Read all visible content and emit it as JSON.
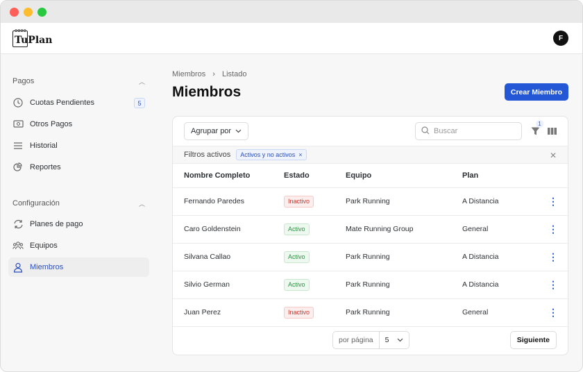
{
  "app": {
    "name": "TuPlan",
    "user_initial": "F"
  },
  "colors": {
    "primary": "#2457d6",
    "active": "#2f8f46",
    "inactive": "#c7362f"
  },
  "sidebar": {
    "pagos": {
      "title": "Pagos",
      "items": [
        {
          "label": "Cuotas Pendientes",
          "icon": "clock-icon",
          "count": "5"
        },
        {
          "label": "Otros Pagos",
          "icon": "cash-icon"
        },
        {
          "label": "Historial",
          "icon": "list-icon"
        },
        {
          "label": "Reportes",
          "icon": "pie-chart-icon"
        }
      ]
    },
    "config": {
      "title": "Configuración",
      "items": [
        {
          "label": "Planes de pago",
          "icon": "refresh-icon"
        },
        {
          "label": "Equipos",
          "icon": "group-icon"
        },
        {
          "label": "Miembros",
          "icon": "user-icon",
          "active": true
        }
      ]
    }
  },
  "main": {
    "breadcrumb": [
      "Miembros",
      "Listado"
    ],
    "title": "Miembros",
    "create_label": "Crear Miembro",
    "group_label": "Agrupar por",
    "search_placeholder": "Buscar",
    "filter_count": "1",
    "filters_label": "Filtros activos",
    "filter_chip": "Activos y no activos",
    "columns": [
      "Nombre Completo",
      "Estado",
      "Equipo",
      "Plan"
    ],
    "rows": [
      {
        "name": "Fernando Paredes",
        "status": "Inactivo",
        "team": "Park Running",
        "plan": "A Distancia"
      },
      {
        "name": "Caro Goldenstein",
        "status": "Activo",
        "team": "Mate Running Group",
        "plan": "General"
      },
      {
        "name": "Silvana Callao",
        "status": "Activo",
        "team": "Park Running",
        "plan": "A Distancia"
      },
      {
        "name": "Silvio German",
        "status": "Activo",
        "team": "Park Running",
        "plan": "A Distancia"
      },
      {
        "name": "Juan Perez",
        "status": "Inactivo",
        "team": "Park Running",
        "plan": "General"
      }
    ],
    "pager_label": "por página",
    "page_size": "5",
    "next_label": "Siguiente"
  }
}
